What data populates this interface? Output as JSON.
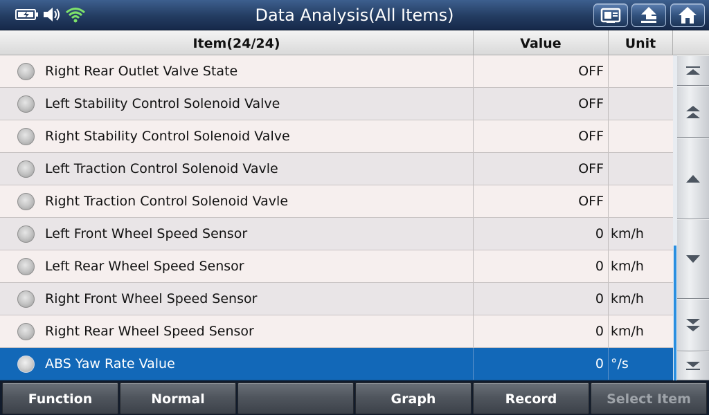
{
  "header": {
    "title": "Data Analysis(All Items)",
    "status_icons": [
      "battery-charging-icon",
      "speaker-icon",
      "wifi-icon"
    ],
    "buttons": [
      "screenshot-icon",
      "back-up-arrow-icon",
      "home-icon"
    ]
  },
  "table": {
    "columns": {
      "item": "Item(24/24)",
      "value": "Value",
      "unit": "Unit"
    },
    "rows": [
      {
        "name": "Right Rear Outlet Valve State",
        "value": "OFF",
        "unit": ""
      },
      {
        "name": "Left Stability Control Solenoid Valve",
        "value": "OFF",
        "unit": ""
      },
      {
        "name": "Right Stability Control Solenoid Valve",
        "value": "OFF",
        "unit": ""
      },
      {
        "name": "Left Traction Control Solenoid Vavle",
        "value": "OFF",
        "unit": ""
      },
      {
        "name": "Right Traction Control Solenoid Vavle",
        "value": "OFF",
        "unit": ""
      },
      {
        "name": "Left Front Wheel Speed Sensor",
        "value": "0",
        "unit": "km/h"
      },
      {
        "name": "Left Rear Wheel Speed Sensor",
        "value": "0",
        "unit": "km/h"
      },
      {
        "name": "Right Front Wheel Speed Sensor",
        "value": "0",
        "unit": "km/h"
      },
      {
        "name": "Right Rear Wheel Speed Sensor",
        "value": "0",
        "unit": "km/h"
      },
      {
        "name": "ABS Yaw Rate Value",
        "value": "0",
        "unit": "°/s",
        "selected": true
      }
    ]
  },
  "scrollbar": {
    "buttons": [
      "scroll-to-top-icon",
      "page-up-icon",
      "line-up-icon",
      "line-down-icon",
      "page-down-icon",
      "scroll-to-bottom-icon"
    ]
  },
  "toolbar": {
    "function_label": "Function",
    "normal_label": "Normal",
    "empty_label": "",
    "graph_label": "Graph",
    "record_label": "Record",
    "select_item_label": "Select Item"
  },
  "colors": {
    "selected_row": "#1268b8",
    "title_bar": "#233c61",
    "scroll_thumb": "#2a8fe0"
  }
}
